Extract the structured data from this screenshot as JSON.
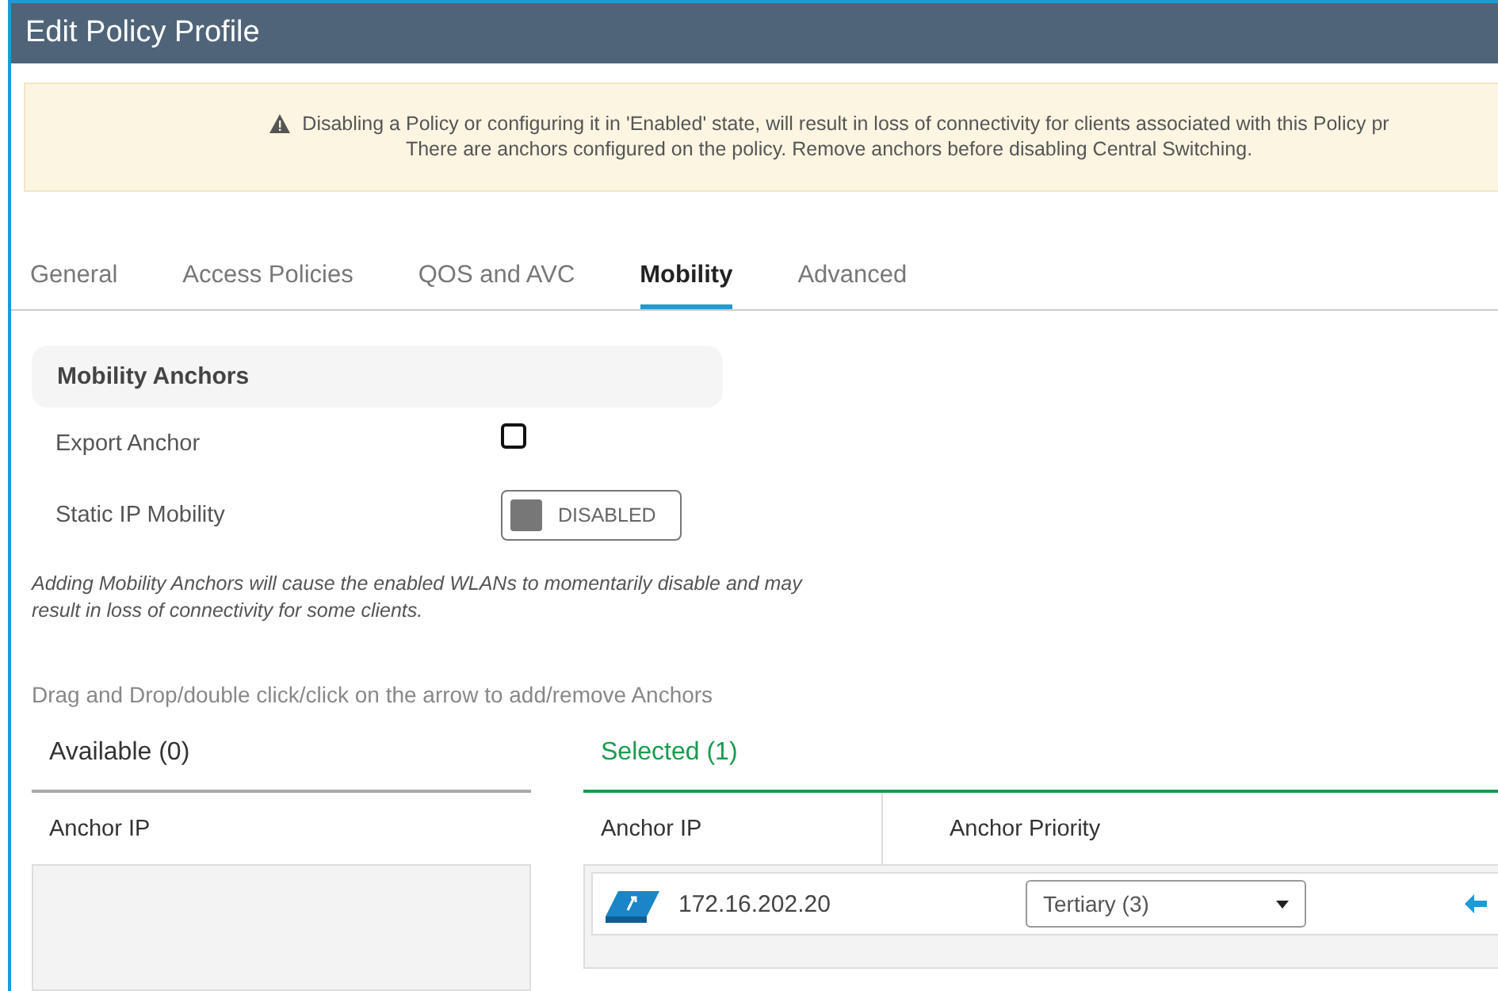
{
  "window": {
    "title": "Edit Policy Profile"
  },
  "warning": {
    "lines": [
      "Disabling a Policy or configuring it in 'Enabled' state, will result in loss of connectivity for clients associated with this Policy pr",
      "There are anchors configured on the policy. Remove anchors before disabling Central Switching."
    ]
  },
  "tabs": [
    {
      "label": "General",
      "selected": false
    },
    {
      "label": "Access Policies",
      "selected": false
    },
    {
      "label": "QOS and AVC",
      "selected": false
    },
    {
      "label": "Mobility",
      "selected": true
    },
    {
      "label": "Advanced",
      "selected": false
    }
  ],
  "section": {
    "title": "Mobility Anchors"
  },
  "fields": [
    {
      "kind": "checkbox",
      "label": "Export Anchor",
      "checked": false
    },
    {
      "kind": "toggle",
      "label": "Static IP Mobility",
      "on": false,
      "state_text": "DISABLED"
    }
  ],
  "note": "Adding Mobility Anchors will cause the enabled WLANs to momentarily disable and may result in loss of connectivity for some clients.",
  "hint": "Drag and Drop/double click/click on the arrow to add/remove Anchors",
  "available": {
    "title": "Available (0)",
    "columns": [
      "Anchor IP"
    ]
  },
  "selected": {
    "title": "Selected (1)",
    "columns": [
      "Anchor IP",
      "Anchor Priority"
    ],
    "rows": [
      {
        "ip": "172.16.202.20",
        "priority": "Tertiary (3)"
      }
    ]
  }
}
